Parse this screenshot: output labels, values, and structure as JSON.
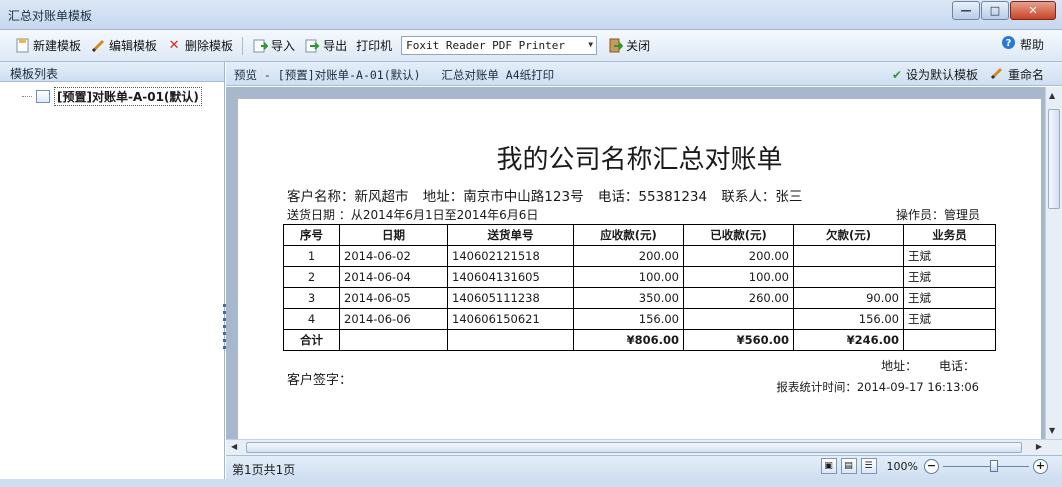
{
  "window": {
    "title": "汇总对账单模板",
    "min": "—",
    "max": "□",
    "close": "✕"
  },
  "toolbar": {
    "new": "新建模板",
    "edit": "编辑模板",
    "delete": "删除模板",
    "import": "导入",
    "export": "导出",
    "printer_label": "打印机",
    "printer_value": "Foxit Reader PDF Printer",
    "close": "关闭",
    "help": "帮助"
  },
  "left_panel": {
    "header": "模板列表",
    "item": "[预置]对账单-A-01(默认)"
  },
  "preview_header": {
    "title": "预览 - [预置]对账单-A-01(默认)   汇总对账单 A4纸打印",
    "set_default": "设为默认模板",
    "rename": "重命名"
  },
  "document": {
    "title": "我的公司名称汇总对账单",
    "customer": "客户名称：新风超市",
    "address": "地址：南京市中山路123号",
    "phone": "电话：55381234",
    "contact": "联系人：张三",
    "delivery_date": "送货日期 ：从2014年6月1日至2014年6月6日",
    "operator": "操作员：管理员",
    "headers": [
      "序号",
      "日期",
      "送货单号",
      "应收款(元)",
      "已收款(元)",
      "欠款(元)",
      "业务员"
    ],
    "rows": [
      [
        "1",
        "2014-06-02",
        "140602121518",
        "200.00",
        "200.00",
        "",
        "王斌"
      ],
      [
        "2",
        "2014-06-04",
        "140604131605",
        "100.00",
        "100.00",
        "",
        "王斌"
      ],
      [
        "3",
        "2014-06-05",
        "140605111238",
        "350.00",
        "260.00",
        "90.00",
        "王斌"
      ],
      [
        "4",
        "2014-06-06",
        "140606150621",
        "156.00",
        "",
        "156.00",
        "王斌"
      ]
    ],
    "total": {
      "label": "合计",
      "receivable": "¥806.00",
      "received": "¥560.00",
      "owed": "¥246.00"
    },
    "signature": "客户签字：",
    "footer_address": "地址：",
    "footer_phone": "电话：",
    "report_time": "报表统计时间：2014-09-17 16:13:06"
  },
  "status": {
    "page": "第1页共1页",
    "zoom": "100%",
    "zoom_level": 0.6
  },
  "colors": {
    "accent": "#1b2d44",
    "delete": "#d42a1a",
    "check": "#2e9a2e",
    "help": "#2a78d4"
  }
}
